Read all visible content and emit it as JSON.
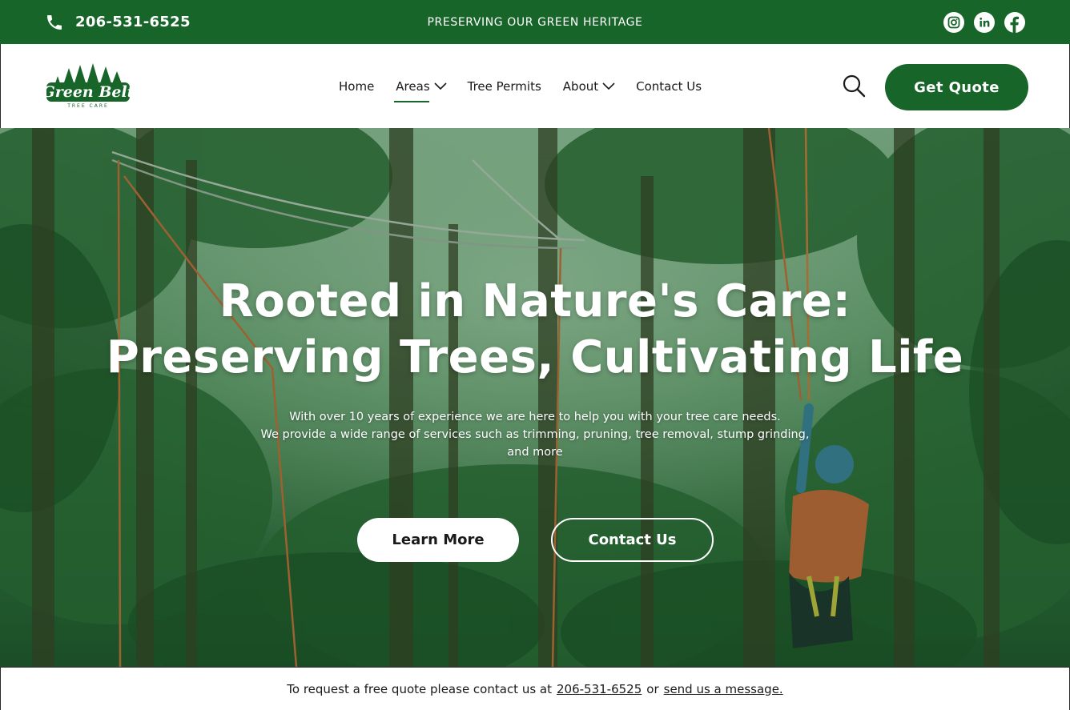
{
  "topbar": {
    "phone": "206-531-6525",
    "tagline": "PRESERVING OUR GREEN HERITAGE",
    "socials": [
      "instagram-icon",
      "linkedin-icon",
      "facebook-icon"
    ]
  },
  "header": {
    "logo_text": "Green Belt",
    "logo_subtext": "TREE CARE",
    "nav": {
      "home": "Home",
      "areas": "Areas",
      "tree_permits": "Tree Permits",
      "about": "About",
      "contact": "Contact Us"
    },
    "quote_button": "Get Quote"
  },
  "hero": {
    "title_line1": "Rooted in Nature's Care:",
    "title_line2": "Preserving Trees, Cultivating Life",
    "desc_line1": "With over 10 years of experience we are here to help you with your tree care needs.",
    "desc_line2": "We provide a wide range of services such as trimming, pruning, tree removal, stump grinding,",
    "desc_line3": "and more",
    "learn_more": "Learn More",
    "contact_us": "Contact Us"
  },
  "bottombar": {
    "prefix": "To request a free quote please contact us at",
    "phone": "206-531-6525",
    "middle": "or",
    "message_link": "send us a message."
  },
  "colors": {
    "brand_green": "#18652a",
    "white": "#ffffff"
  }
}
